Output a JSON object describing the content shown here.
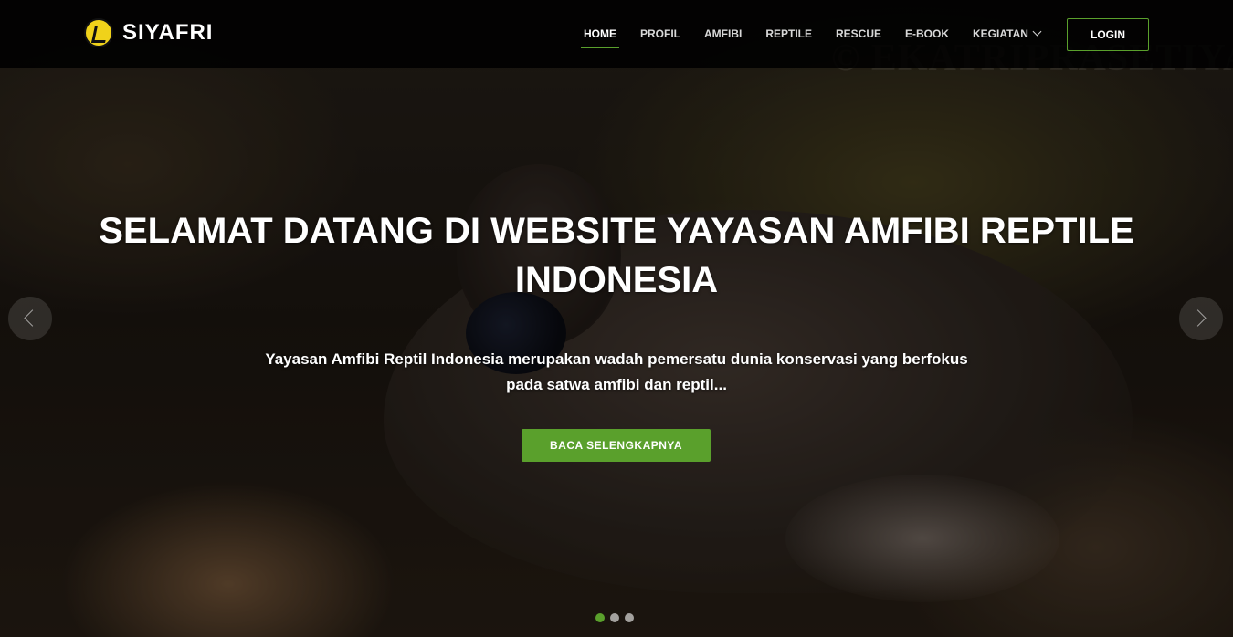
{
  "brand": {
    "name": "SIYAFRI",
    "logo_icon": "siyafri-logo-icon"
  },
  "nav": {
    "items": [
      {
        "label": "HOME",
        "active": true
      },
      {
        "label": "PROFIL",
        "active": false
      },
      {
        "label": "AMFIBI",
        "active": false
      },
      {
        "label": "REPTILE",
        "active": false
      },
      {
        "label": "RESCUE",
        "active": false
      },
      {
        "label": "E-BOOK",
        "active": false
      },
      {
        "label": "KEGIATAN",
        "active": false,
        "has_dropdown": true
      }
    ],
    "login_label": "LOGIN"
  },
  "hero": {
    "title": "SELAMAT DATANG DI WEBSITE YAYASAN AMFIBI REPTILE INDONESIA",
    "subtitle": "Yayasan Amfibi Reptil Indonesia merupakan wadah pemersatu dunia konservasi yang berfokus pada satwa amfibi dan reptil...",
    "cta_label": "BACA SELENGKAPNYA",
    "watermark": "© EKATRIPRASETIYA"
  },
  "carousel": {
    "prev_icon": "chevron-left-icon",
    "next_icon": "chevron-right-icon",
    "slide_count": 3,
    "active_index": 0
  },
  "colors": {
    "accent": "#5aa02c",
    "header_bg": "#000000",
    "logo_yellow": "#f0d21a"
  }
}
